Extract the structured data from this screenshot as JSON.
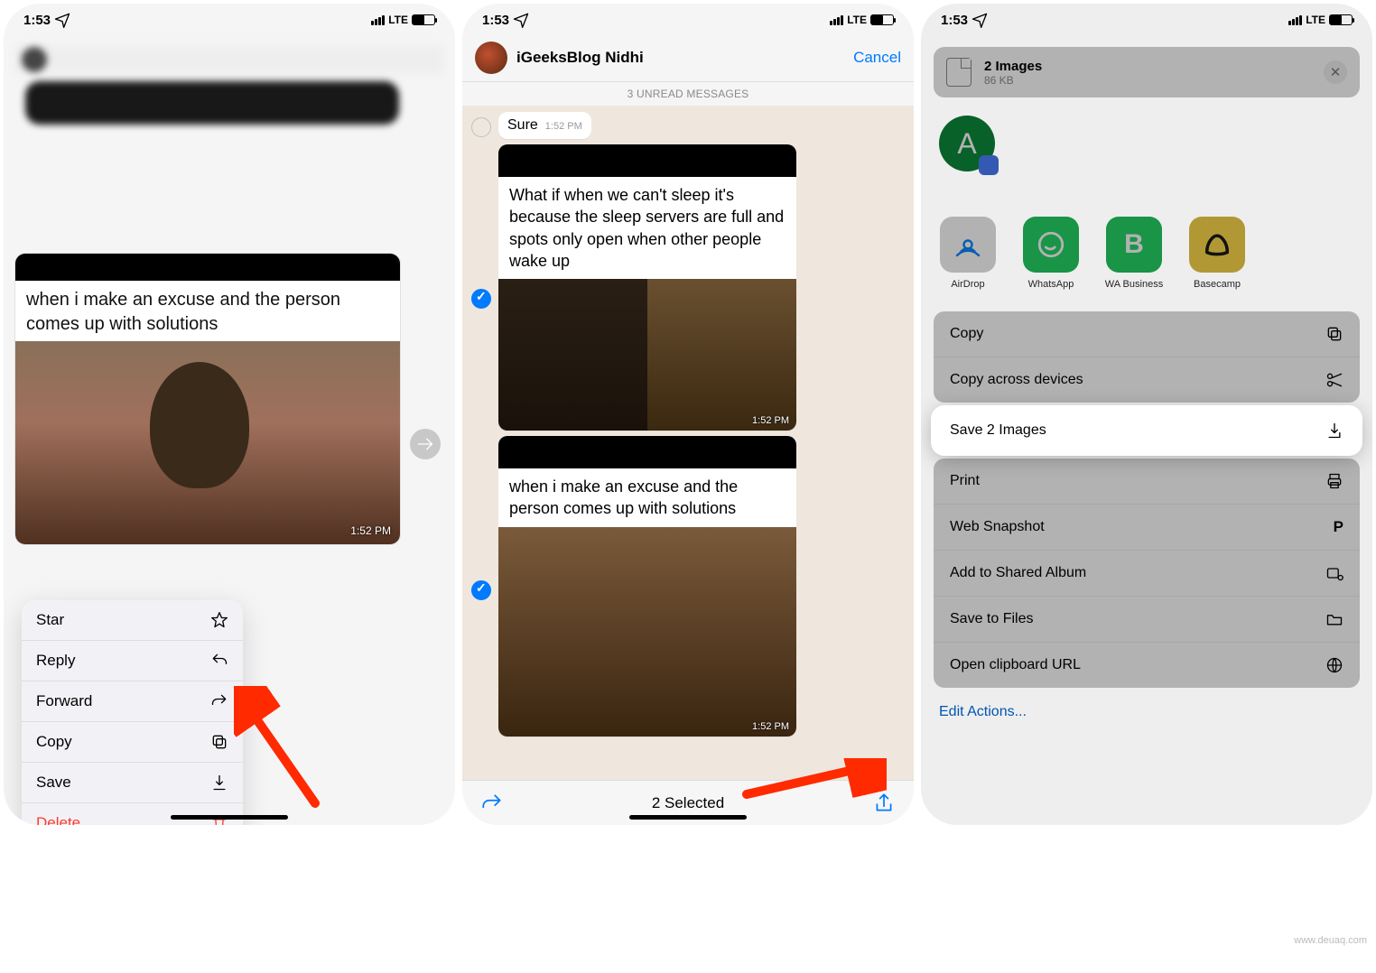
{
  "status": {
    "time": "1:53",
    "network": "LTE"
  },
  "phone1": {
    "meme_text": "when i make an excuse and the person comes up with solutions",
    "timestamp": "1:52 PM",
    "menu": {
      "star": "Star",
      "reply": "Reply",
      "forward": "Forward",
      "copy": "Copy",
      "save": "Save",
      "delete": "Delete"
    }
  },
  "phone2": {
    "contact": "iGeeksBlog Nidhi",
    "cancel": "Cancel",
    "unread": "3 UNREAD MESSAGES",
    "msg1": {
      "text": "Sure",
      "time": "1:52 PM"
    },
    "meme1_text": "What if when we can't sleep it's because the sleep servers are full and spots only open when other people wake up",
    "meme1_time": "1:52 PM",
    "meme2_text": "when i make an excuse and the person comes up with solutions",
    "meme2_time": "1:52 PM",
    "selected": "2 Selected"
  },
  "phone3": {
    "header": {
      "title": "2 Images",
      "subtitle": "86 KB"
    },
    "avatar_letter": "A",
    "apps": {
      "airdrop": "AirDrop",
      "whatsapp": "WhatsApp",
      "wabiz": "WA Business",
      "basecamp": "Basecamp"
    },
    "actions": {
      "copy": "Copy",
      "copy_across": "Copy across devices",
      "save": "Save 2 Images",
      "print": "Print",
      "web": "Web Snapshot",
      "album": "Add to Shared Album",
      "files": "Save to Files",
      "clipboard": "Open clipboard URL",
      "edit": "Edit Actions..."
    }
  },
  "watermark": "www.deuaq.com"
}
